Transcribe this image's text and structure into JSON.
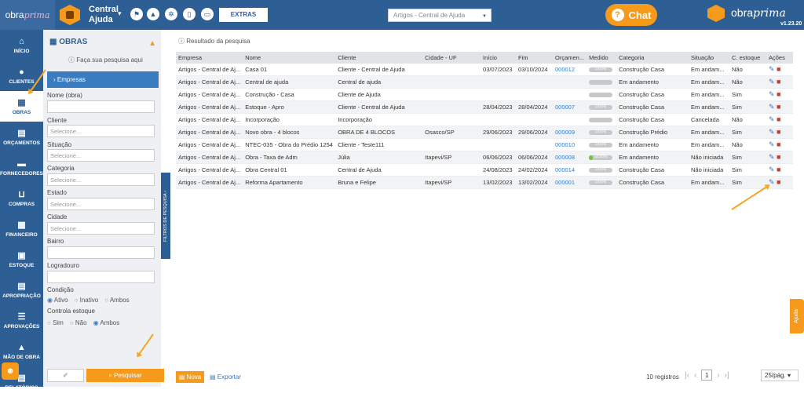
{
  "header": {
    "logo_text": "obra",
    "logo_italic": "prima",
    "company": "Central Ajuda",
    "extras_label": "EXTRAS",
    "company_select": "Artigos - Central de Ajuda",
    "chat_label": "Chat",
    "brand_text": "obra",
    "brand_italic": "prima",
    "version": "v1.23.20"
  },
  "sidebar": {
    "items": [
      {
        "label": "INÍCIO",
        "icon": "home-icon",
        "glyph": "⌂"
      },
      {
        "label": "CLIENTES",
        "icon": "user-icon",
        "glyph": "●"
      },
      {
        "label": "OBRAS",
        "icon": "building-icon",
        "glyph": "▦"
      },
      {
        "label": "ORÇAMENTOS",
        "icon": "document-icon",
        "glyph": "▤"
      },
      {
        "label": "FORNECEDORES",
        "icon": "truck-icon",
        "glyph": "▬"
      },
      {
        "label": "COMPRAS",
        "icon": "cart-icon",
        "glyph": "⊔"
      },
      {
        "label": "FINANCEIRO",
        "icon": "calculator-icon",
        "glyph": "▦"
      },
      {
        "label": "ESTOQUE",
        "icon": "boxes-icon",
        "glyph": "▣"
      },
      {
        "label": "APROPRIAÇÃO",
        "icon": "file-icon",
        "glyph": "▤"
      },
      {
        "label": "APROVAÇÕES",
        "icon": "checklist-icon",
        "glyph": "☰"
      },
      {
        "label": "MÃO DE OBRA",
        "icon": "worker-icon",
        "glyph": "▲"
      },
      {
        "label": "RELATÓRIOS",
        "icon": "report-icon",
        "glyph": "▤"
      }
    ]
  },
  "filters": {
    "title": "OBRAS",
    "hint": "Faça sua pesquisa aqui",
    "empresas_label": "Empresas",
    "nome_label": "Nome (obra)",
    "cliente_label": "Cliente",
    "cliente_placeholder": "Selecione...",
    "situacao_label": "Situação",
    "situacao_placeholder": "Selecione...",
    "categoria_label": "Categoria",
    "categoria_placeholder": "Selecione...",
    "estado_label": "Estado",
    "estado_placeholder": "Selecione...",
    "cidade_label": "Cidade",
    "cidade_placeholder": "Selecione...",
    "bairro_label": "Bairro",
    "logradouro_label": "Logradouro",
    "condicao_label": "Condição",
    "condicao_options": [
      "Ativo",
      "Inativo",
      "Ambos"
    ],
    "estoque_label": "Controla estoque",
    "estoque_options": [
      "Sim",
      "Não",
      "Ambos"
    ],
    "search_label": "Pesquisar",
    "collapse_label": "FILTROS DE PESQUISA"
  },
  "results": {
    "title": "Resultado da pesquisa",
    "columns": [
      "Empresa",
      "Nome",
      "Cliente",
      "Cidade - UF",
      "Início",
      "Fim",
      "Orçamen...",
      "Medido",
      "Categoria",
      "Situação",
      "C. estoque",
      "Ações"
    ],
    "rows": [
      {
        "empresa": "Artigos - Central de Aj...",
        "nome": "Casa 01",
        "cliente": "Cliente - Central de Ajuda",
        "cidade": "",
        "inicio": "03/07/2023",
        "fim": "03/10/2024",
        "orc": "000012",
        "medido": "0,00%",
        "medido_val": 0,
        "categoria": "Construção Casa",
        "situacao": "Em andam...",
        "estoque": "Não"
      },
      {
        "empresa": "Artigos - Central de Aj...",
        "nome": "Central de ajuda",
        "cliente": "Central de ajuda",
        "cidade": "",
        "inicio": "",
        "fim": "",
        "orc": "",
        "medido": "",
        "medido_val": 0,
        "categoria": "Em andamento",
        "situacao": "Em andam...",
        "estoque": "Não"
      },
      {
        "empresa": "Artigos - Central de Aj...",
        "nome": "Construção - Casa",
        "cliente": "Cliente de Ajuda",
        "cidade": "",
        "inicio": "",
        "fim": "",
        "orc": "",
        "medido": "",
        "medido_val": 0,
        "categoria": "Construção Casa",
        "situacao": "Em andam...",
        "estoque": "Sim"
      },
      {
        "empresa": "Artigos - Central de Aj...",
        "nome": "Estoque - Apro",
        "cliente": "Cliente - Central de Ajuda",
        "cidade": "",
        "inicio": "28/04/2023",
        "fim": "28/04/2024",
        "orc": "000007",
        "medido": "0,00%",
        "medido_val": 0,
        "categoria": "Construção Casa",
        "situacao": "Em andam...",
        "estoque": "Sim"
      },
      {
        "empresa": "Artigos - Central de Aj...",
        "nome": "Incorporação",
        "cliente": "Incorporação",
        "cidade": "",
        "inicio": "",
        "fim": "",
        "orc": "",
        "medido": "",
        "medido_val": 0,
        "categoria": "Construção Casa",
        "situacao": "Cancelada",
        "estoque": "Não"
      },
      {
        "empresa": "Artigos - Central de Aj...",
        "nome": "Novo obra - 4 blocos",
        "cliente": "OBRA DE 4 BLOCOS",
        "cidade": "Osasco/SP",
        "inicio": "29/06/2023",
        "fim": "29/06/2024",
        "orc": "000009",
        "medido": "0,00%",
        "medido_val": 0,
        "categoria": "Construção Prédio",
        "situacao": "Em andam...",
        "estoque": "Sim"
      },
      {
        "empresa": "Artigos - Central de Aj...",
        "nome": "NTEC-035 - Obra do Prédio 1254",
        "cliente": "Cliente - Teste111",
        "cidade": "",
        "inicio": "",
        "fim": "",
        "orc": "000010",
        "medido": "0,00%",
        "medido_val": 0,
        "categoria": "Em andamento",
        "situacao": "Em andam...",
        "estoque": "Não"
      },
      {
        "empresa": "Artigos - Central de Aj...",
        "nome": "Obra - Taxa de Adm",
        "cliente": "Júlia",
        "cidade": "Itapevi/SP",
        "inicio": "06/06/2023",
        "fim": "06/06/2024",
        "orc": "000008",
        "medido": "18,00%",
        "medido_val": 18,
        "categoria": "Em andamento",
        "situacao": "Não iniciada",
        "estoque": "Sim"
      },
      {
        "empresa": "Artigos - Central de Aj...",
        "nome": "Obra Central 01",
        "cliente": "Central de Ajuda",
        "cidade": "",
        "inicio": "24/08/2023",
        "fim": "24/02/2024",
        "orc": "000014",
        "medido": "0,00%",
        "medido_val": 0,
        "categoria": "Construção Casa",
        "situacao": "Não iniciada",
        "estoque": "Sim"
      },
      {
        "empresa": "Artigos - Central de Aj...",
        "nome": "Reforma Apartamento",
        "cliente": "Bruna e Felipe",
        "cidade": "Itapevi/SP",
        "inicio": "13/02/2023",
        "fim": "13/02/2024",
        "orc": "000001",
        "medido": "0,00%",
        "medido_val": 0,
        "categoria": "Construção Casa",
        "situacao": "Em andam...",
        "estoque": "Sim"
      }
    ]
  },
  "footer": {
    "nova_label": "Nova",
    "exportar_label": "Exportar",
    "registros": "10 registros",
    "page": "1",
    "per_page": "25/pág."
  },
  "help_tab": "Ajuda",
  "colors": {
    "primary": "#2e5f94",
    "accent": "#f59a1b",
    "link": "#3a7cc0",
    "delete": "#d9342b"
  }
}
